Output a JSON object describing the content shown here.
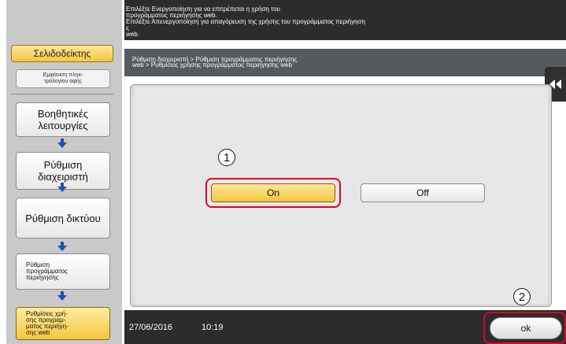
{
  "sidebar": {
    "bookmark_label": "Σελιδοδείκτης",
    "keypad_label": "Εμφάνιση πληκ-\nτρολογίου αφής",
    "crumbs": [
      "Βοηθητικές\nλειτουργίες",
      "Ρύθμιση\nδιαχειριστή",
      "Ρύθμιση δικτύου",
      "Ρύθμιση\nπρογράμματος\nπεριήγησης",
      "Ρυθμίσεις χρή-\nσης προγραμ-\nματος περιήγη-\nσης web"
    ]
  },
  "header": {
    "message": "Επιλέξτε Ενεργοποίηση για να επιτρέπεται η χρήση του\nπρογράμματος περιήγησης web.\nΕπιλέξτε Απενεργοποίηση για απαγόρευση της χρήσης του προγράμματος περιήγηση\nς\nweb."
  },
  "path": {
    "text": "Ρύθμιση διαχειριστή > Ρύθμιση προγράμματος περιήγησης\nweb > Ρυθμίσεις χρήσης προγράμματος περιήγησης web"
  },
  "options": {
    "on_label": "On",
    "off_label": "Off",
    "selected": "On"
  },
  "callouts": {
    "first": "1",
    "second": "2"
  },
  "footer": {
    "date": "27/06/2016",
    "time": "10:19",
    "ok_label": "ok"
  },
  "colors": {
    "selected_fill": "#f4c640",
    "highlight_ring": "#e0002a",
    "header_bg": "#2c2c2c"
  },
  "icons": {
    "collapse": "double-chevron-left-icon",
    "flow_arrow": "arrow-down-icon"
  }
}
